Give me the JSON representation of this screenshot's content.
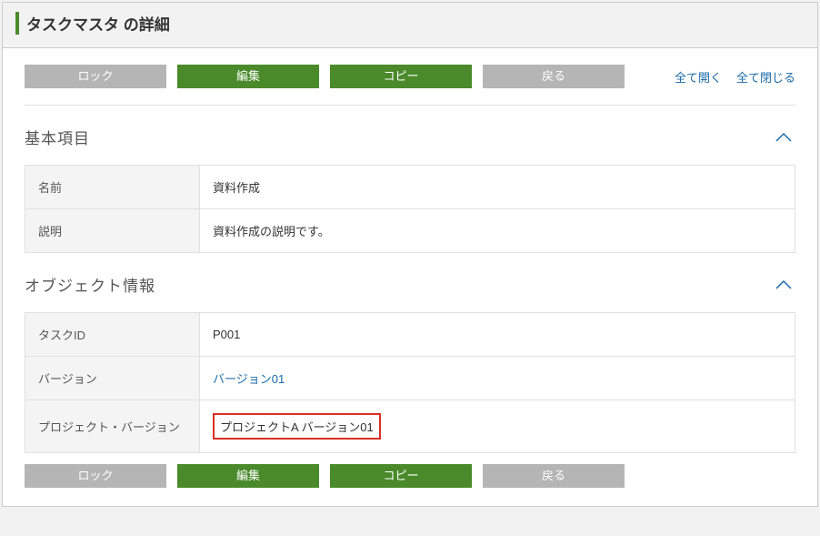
{
  "page": {
    "title": "タスクマスタ の詳細"
  },
  "buttons": {
    "lock": "ロック",
    "edit": "編集",
    "copy": "コピー",
    "back": "戻る"
  },
  "links": {
    "expand_all": "全て開く",
    "collapse_all": "全て閉じる"
  },
  "sections": {
    "basic": {
      "title": "基本項目",
      "rows": {
        "name_label": "名前",
        "name_value": "資料作成",
        "desc_label": "説明",
        "desc_value": "資料作成の説明です。"
      }
    },
    "object": {
      "title": "オブジェクト情報",
      "rows": {
        "taskid_label": "タスクID",
        "taskid_value": "P001",
        "version_label": "バージョン",
        "version_value": "バージョン01",
        "projver_label": "プロジェクト・バージョン",
        "projver_value": "プロジェクトA バージョン01"
      }
    }
  }
}
